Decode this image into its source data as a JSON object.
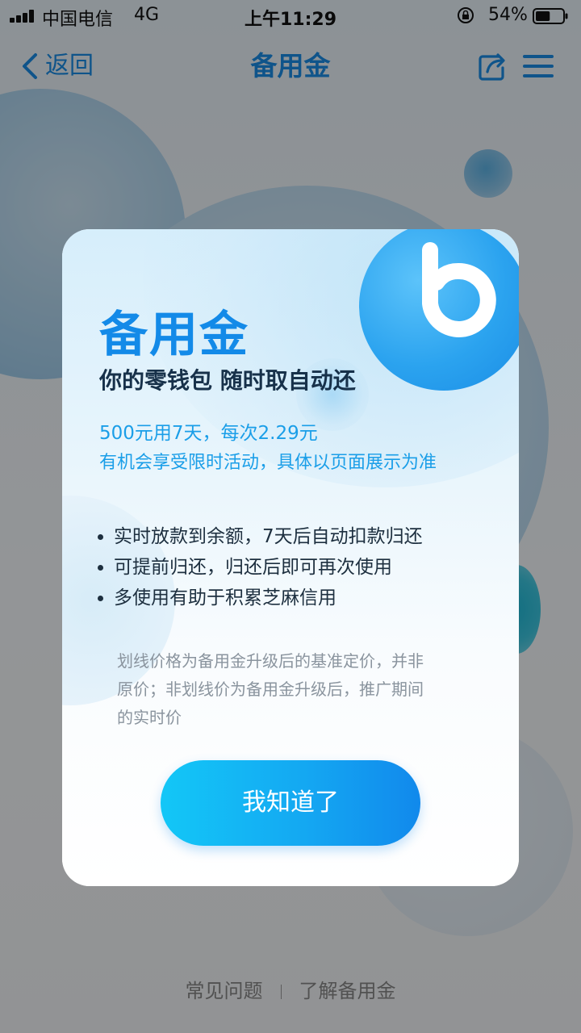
{
  "status_bar": {
    "carrier": "中国电信",
    "network": "4G",
    "time": "上午11:29",
    "battery_percent": "54%",
    "battery_level": 0.54
  },
  "nav": {
    "back_label": "返回",
    "title": "备用金"
  },
  "modal": {
    "title": "备用金",
    "subtitle": "你的零钱包 随时取自动还",
    "promo_line_1": "500元用7天，每次2.29元",
    "promo_line_2": "有机会享受限时活动，具体以页面展示为准",
    "features": [
      "实时放款到余额，7天后自动扣款归还",
      "可提前归还，归还后即可再次使用",
      "多使用有助于积累芝麻信用"
    ],
    "note_lines": [
      "划线价格为备用金升级后的基准定价，并非",
      "原价；非划线价为备用金升级后，推广期间",
      "的实时价"
    ],
    "button_label": "我知道了"
  },
  "footer": {
    "faq_label": "常见问题",
    "learn_label": "了解备用金"
  },
  "colors": {
    "accent": "#1a8de6",
    "brand_blue": "#138ae8",
    "promo_blue": "#1a9ee8",
    "button_start": "#13c7f7",
    "button_end": "#1189ec",
    "text_dark": "#1d2f3f",
    "note_gray": "#8a949e"
  },
  "icons": {
    "back": "chevron-left-icon",
    "share": "share-icon",
    "menu": "menu-icon",
    "brand": "b-logo-icon"
  }
}
